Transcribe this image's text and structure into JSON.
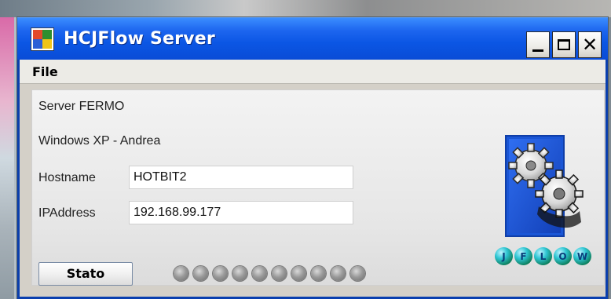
{
  "window": {
    "title": "HCJFlow Server"
  },
  "menu": {
    "file": "File"
  },
  "server": {
    "status_text": "Server FERMO",
    "os_user": "Windows XP - Andrea",
    "hostname_label": "Hostname",
    "hostname_value": "HOTBIT2",
    "ip_label": "IPAddress",
    "ip_value": "192.168.99.177"
  },
  "stato_button": "Stato",
  "leds": {
    "count": 10,
    "state": "off"
  },
  "logo": {
    "icon": "gears-icon",
    "letters": [
      "J",
      "F",
      "L",
      "O",
      "W"
    ]
  },
  "colors": {
    "titlebar": "#0b56e4",
    "led_off": "#8c8c8c",
    "logo_blue": "#1a56d6",
    "ball_green": "#17a67a"
  }
}
